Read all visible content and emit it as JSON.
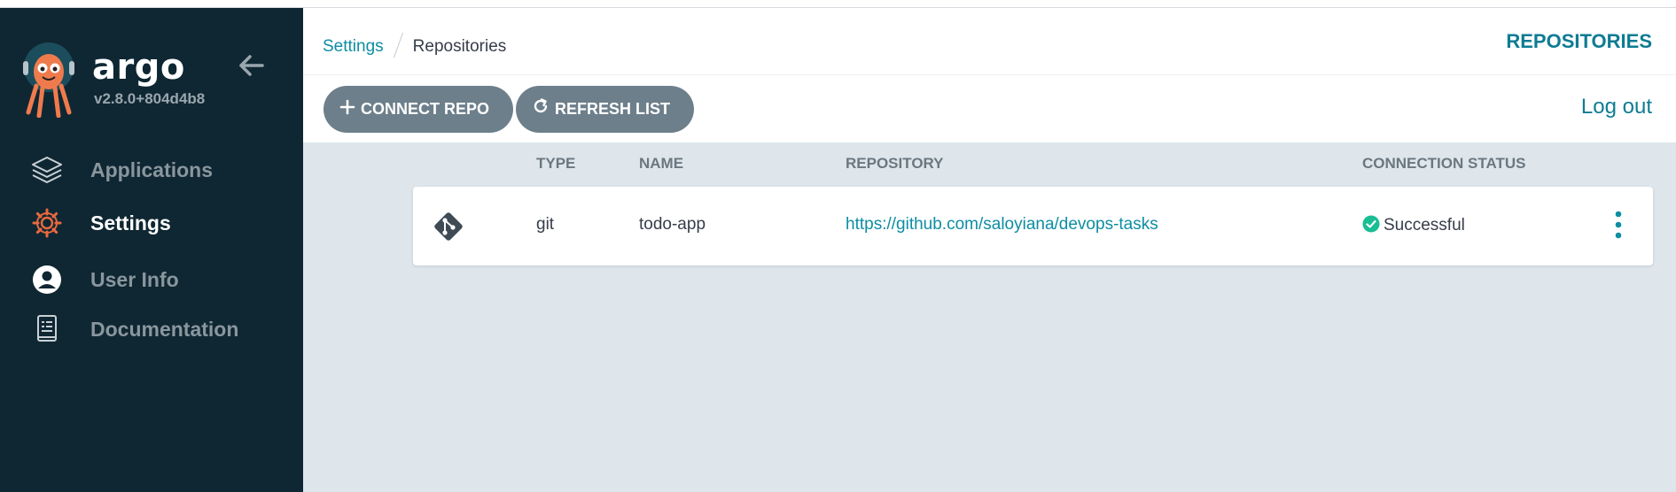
{
  "app": {
    "name": "argo",
    "version": "v2.8.0+804d4b8"
  },
  "sidebar": {
    "items": [
      {
        "label": "Applications",
        "icon": "layers-icon",
        "active": false
      },
      {
        "label": "Settings",
        "icon": "gear-icon",
        "active": true
      },
      {
        "label": "User Info",
        "icon": "user-circle-icon",
        "active": false
      },
      {
        "label": "Documentation",
        "icon": "book-icon",
        "active": false
      }
    ]
  },
  "header": {
    "breadcrumb": [
      "Settings",
      "Repositories"
    ],
    "title": "REPOSITORIES",
    "logout_label": "Log out"
  },
  "toolbar": {
    "connect_label": "CONNECT REPO",
    "refresh_label": "REFRESH LIST"
  },
  "table": {
    "columns": [
      "TYPE",
      "NAME",
      "REPOSITORY",
      "CONNECTION STATUS"
    ],
    "rows": [
      {
        "type": "git",
        "name": "todo-app",
        "repository": "https://github.com/saloyiana/devops-tasks",
        "status": "Successful",
        "type_icon": "git-icon",
        "status_icon": "check-circle-icon"
      }
    ]
  },
  "colors": {
    "sidebar_bg": "#0f2733",
    "accent": "#0c8ea3",
    "button_bg": "#6d7f8b",
    "content_bg": "#dee6eb",
    "success": "#18be94",
    "settings_icon": "#e9693f"
  }
}
